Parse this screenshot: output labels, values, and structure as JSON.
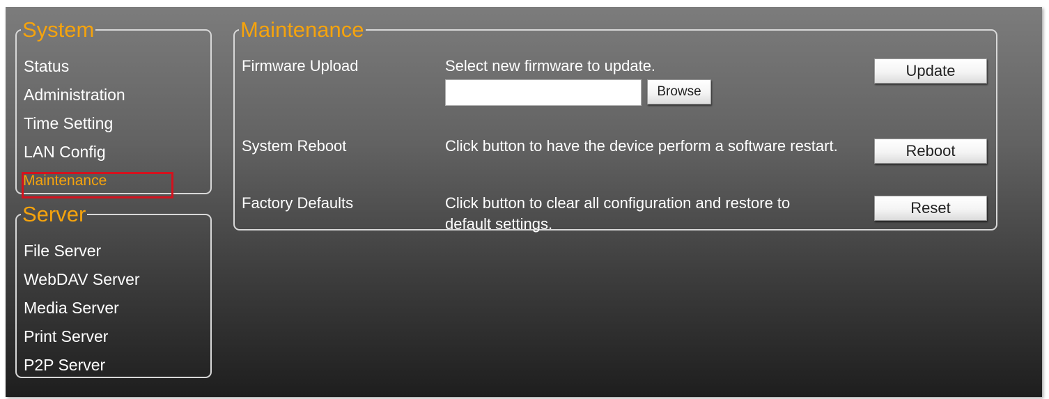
{
  "sidebar": {
    "system": {
      "title": "System",
      "items": [
        {
          "label": "Status"
        },
        {
          "label": "Administration"
        },
        {
          "label": "Time Setting"
        },
        {
          "label": "LAN Config"
        },
        {
          "label": "Maintenance",
          "active": true
        }
      ]
    },
    "server": {
      "title": "Server",
      "items": [
        {
          "label": "File Server"
        },
        {
          "label": "WebDAV Server"
        },
        {
          "label": "Media Server"
        },
        {
          "label": "Print Server"
        },
        {
          "label": "P2P Server"
        }
      ]
    }
  },
  "main": {
    "title": "Maintenance",
    "firmware": {
      "label": "Firmware Upload",
      "description": "Select new firmware to update.",
      "file_value": "",
      "browse_label": "Browse",
      "button_label": "Update"
    },
    "reboot": {
      "label": "System Reboot",
      "description": "Click button to have the device perform a software restart.",
      "button_label": "Reboot"
    },
    "factory": {
      "label": "Factory Defaults",
      "description_line1": "Click button to clear all configuration and restore to",
      "description_line2": "default settings.",
      "button_label": "Reset"
    }
  },
  "colors": {
    "accent": "#f5a30d",
    "highlight_border": "#d3121e",
    "text": "#ffffff"
  }
}
